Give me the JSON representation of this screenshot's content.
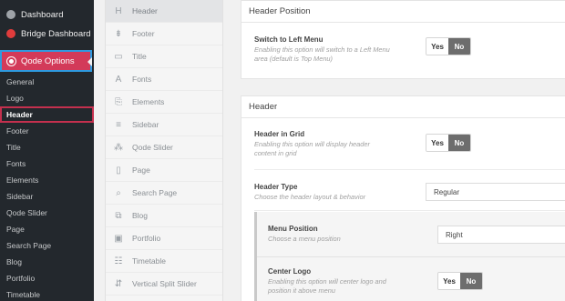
{
  "wp_menu": {
    "dashboard": "Dashboard",
    "bridge_dashboard": "Bridge Dashboard",
    "qode_options": "Qode Options",
    "submenu": [
      "General",
      "Logo",
      "Header",
      "Footer",
      "Title",
      "Fonts",
      "Elements",
      "Sidebar",
      "Qode Slider",
      "Page",
      "Search Page",
      "Blog",
      "Portfolio",
      "Timetable"
    ],
    "current": "Header"
  },
  "qode_tabs": [
    {
      "label": "Header",
      "icon": "header-icon",
      "glyph": "H"
    },
    {
      "label": "Footer",
      "icon": "footer-icon",
      "glyph": "⇟"
    },
    {
      "label": "Title",
      "icon": "title-icon",
      "glyph": "▭"
    },
    {
      "label": "Fonts",
      "icon": "fonts-icon",
      "glyph": "A"
    },
    {
      "label": "Elements",
      "icon": "elements-icon",
      "glyph": "⎘"
    },
    {
      "label": "Sidebar",
      "icon": "sidebar-icon",
      "glyph": "≡"
    },
    {
      "label": "Qode Slider",
      "icon": "slider-icon",
      "glyph": "⁂"
    },
    {
      "label": "Page",
      "icon": "page-icon",
      "glyph": "▯"
    },
    {
      "label": "Search Page",
      "icon": "search-icon",
      "glyph": "⌕"
    },
    {
      "label": "Blog",
      "icon": "blog-icon",
      "glyph": "⧉"
    },
    {
      "label": "Portfolio",
      "icon": "portfolio-icon",
      "glyph": "▣"
    },
    {
      "label": "Timetable",
      "icon": "timetable-icon",
      "glyph": "☷"
    },
    {
      "label": "Vertical Split Slider",
      "icon": "split-slider-icon",
      "glyph": "⇵"
    }
  ],
  "header_position": {
    "title": "Header Position",
    "switch_left_menu": {
      "label": "Switch to Left Menu",
      "desc_line1": "Enabling this option will switch to a Left Menu",
      "desc_line2": "area (default is Top Menu)",
      "yes": "Yes",
      "no": "No"
    }
  },
  "header": {
    "title": "Header",
    "header_in_grid": {
      "label": "Header in Grid",
      "desc_line1": "Enabling this option will display header",
      "desc_line2": "content in grid",
      "yes": "Yes",
      "no": "No"
    },
    "header_type": {
      "label": "Header Type",
      "desc": "Choose the header layout & behavior",
      "value": "Regular"
    },
    "menu_position": {
      "label": "Menu Position",
      "desc": "Choose a menu position",
      "value": "Right"
    },
    "center_logo": {
      "label": "Center Logo",
      "desc_line1": "Enabling this option will center logo and",
      "desc_line2": "position it above menu",
      "yes": "Yes",
      "no": "No"
    }
  },
  "colors": {
    "wp_sidebar": "#23282d",
    "qode_accent": "#d33a59",
    "highlight_border": "#c4304e",
    "selection_blue": "#2e9ae0",
    "toggle_no": "#6d6d6d"
  }
}
